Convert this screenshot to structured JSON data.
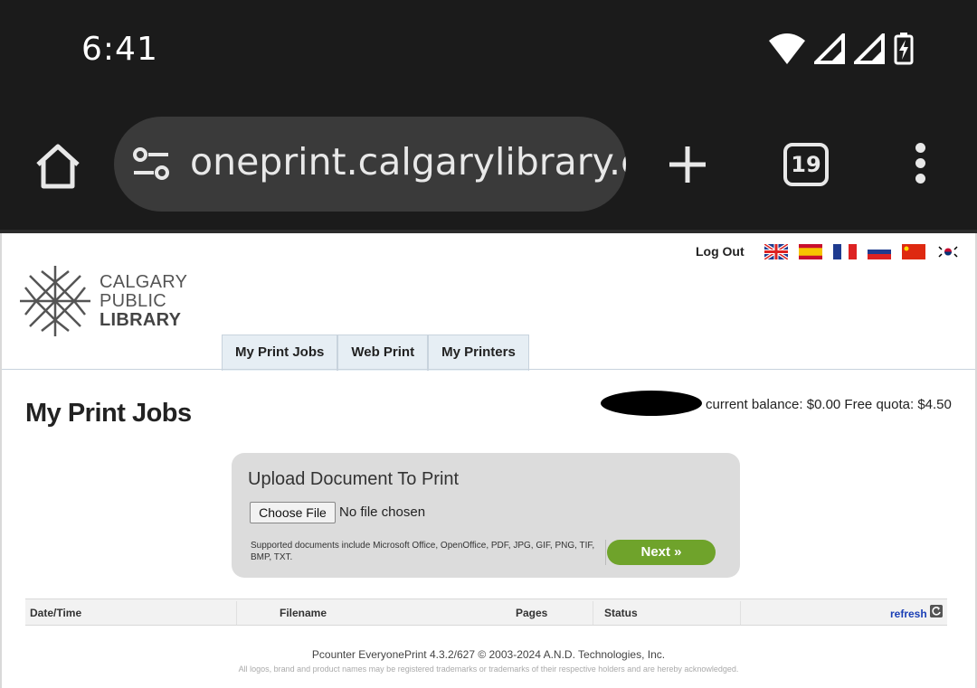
{
  "status_bar": {
    "time": "6:41",
    "icons": [
      "wifi-icon",
      "signal-icon",
      "signal-icon",
      "battery-charging-icon"
    ]
  },
  "browser": {
    "url": "oneprint.calgarylibrary.ca",
    "tab_count": "19"
  },
  "page": {
    "logo_lines": [
      "CALGARY",
      "PUBLIC",
      "LIBRARY"
    ],
    "logout": "Log Out",
    "flags": [
      "uk-flag-icon",
      "spain-flag-icon",
      "france-flag-icon",
      "russia-flag-icon",
      "china-flag-icon",
      "korea-flag-icon"
    ],
    "tabs": [
      {
        "label": "My Print Jobs"
      },
      {
        "label": "Web Print"
      },
      {
        "label": "My Printers"
      }
    ],
    "title": "My Print Jobs",
    "balance": "current balance: $0.00 Free quota: $4.50",
    "upload": {
      "title": "Upload Document To Print",
      "choose_file": "Choose File",
      "no_file": "No file chosen",
      "supported": "Supported documents include Microsoft Office, OpenOffice, PDF, JPG, GIF, PNG, TIF, BMP, TXT.",
      "next": "Next »"
    },
    "jobs_table": {
      "columns": [
        "Date/Time",
        "Filename",
        "Pages",
        "Status"
      ],
      "refresh": "refresh"
    },
    "footer": "Pcounter EveryonePrint 4.3.2/627 © 2003-2024 A.N.D. Technologies, Inc.",
    "footer_small": "All logos, brand and product names may be registered trademarks or trademarks of their respective holders and are hereby acknowledged."
  }
}
